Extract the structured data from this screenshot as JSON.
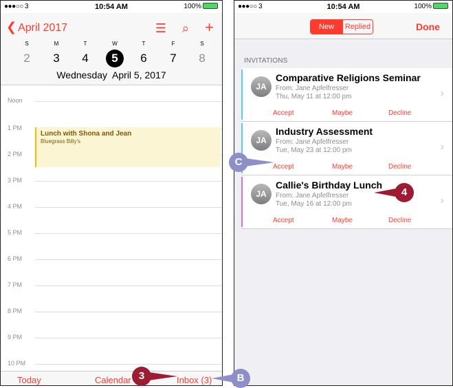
{
  "left": {
    "status": {
      "signal": "●●●○○ 3",
      "time": "10:54 AM",
      "battery": "100%"
    },
    "header": {
      "back_label": "April 2017",
      "list_icon": "list-icon",
      "search_icon": "search-icon",
      "add_icon": "plus-icon"
    },
    "week_letters": [
      "S",
      "M",
      "T",
      "W",
      "T",
      "F",
      "S"
    ],
    "week_days": [
      "2",
      "3",
      "4",
      "5",
      "6",
      "7",
      "8"
    ],
    "selected_day": "5",
    "date_title": "Wednesday  April 5, 2017",
    "hours": [
      "Noon",
      "1 PM",
      "2 PM",
      "3 PM",
      "4 PM",
      "5 PM",
      "6 PM",
      "7 PM",
      "8 PM",
      "9 PM",
      "10 PM"
    ],
    "event": {
      "title": "Lunch with Shona and Jean",
      "location": "Bluegrass Billy's"
    },
    "tabbar": {
      "today": "Today",
      "calendars": "Calendar",
      "inbox": "Inbox (3)"
    }
  },
  "right": {
    "status": {
      "signal": "●●●○○ 3",
      "time": "10:54 AM",
      "battery": "100%"
    },
    "segments": {
      "new": "New",
      "replied": "Replied"
    },
    "done": "Done",
    "section": "INVITATIONS",
    "invitations": [
      {
        "avatar": "JA",
        "title": "Comparative Religions Seminar",
        "from": "From: Jane Apfelfresser",
        "when": "Thu, May 11 at 12:00 pm",
        "accept": "Accept",
        "maybe": "Maybe",
        "decline": "Decline",
        "color": "#5ac8fa"
      },
      {
        "avatar": "JA",
        "title": "Industry Assessment",
        "from": "From: Jane Apfelfresser",
        "when": "Tue, May 23 at 12:00 pm",
        "accept": "Accept",
        "maybe": "Maybe",
        "decline": "Decline",
        "color": "#5ac8fa"
      },
      {
        "avatar": "JA",
        "title": "Callie's Birthday Lunch",
        "from": "From: Jane Apfelfresser",
        "when": "Tue, May 16 at 12:00 pm",
        "accept": "Accept",
        "maybe": "Maybe",
        "decline": "Decline",
        "color": "#cc73e1"
      }
    ]
  },
  "callouts": {
    "three": "3",
    "b": "B",
    "c": "C",
    "four": "4"
  },
  "colors": {
    "accent": "#ff3b30",
    "callout_dark": "#9e1b32",
    "callout_light": "#8e8ec8"
  }
}
